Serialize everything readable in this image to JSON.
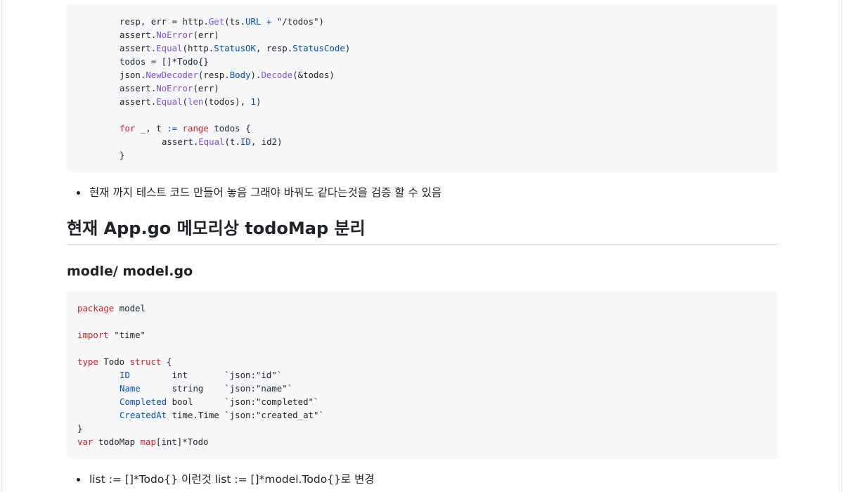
{
  "code_block_1": {
    "lines": [
      "resp, err = http.Get(ts.URL + \"/todos\")",
      "assert.NoError(err)",
      "assert.Equal(http.StatusOK, resp.StatusCode)",
      "todos = []*Todo{}",
      "json.NewDecoder(resp.Body).Decode(&todos)",
      "assert.NoError(err)",
      "assert.Equal(len(todos), 1)",
      "",
      "for _, t := range todos {",
      "assert.Equal(t.ID, id2)",
      "}"
    ]
  },
  "bullet_1": "현재 까지 테스트 코드 만들어 놓음 그래야 바꿔도 같다는것을 검증 할 수 있음",
  "heading_2": "현재 App.go 메모리상 todoMap 분리",
  "heading_3": "modle/ model.go",
  "code_block_2": {
    "lines": [
      "package model",
      "",
      "import \"time\"",
      "",
      "type Todo struct {",
      "ID        int       `json:\"id\"`",
      "Name      string    `json:\"name\"`",
      "Completed bool      `json:\"completed\"`",
      "CreatedAt time.Time `json:\"created_at\"`",
      "}",
      "var todoMap map[int]*Todo"
    ]
  },
  "bullet_2": "list := []*Todo{} 이런것 list := []*model.Todo{}로 변경",
  "colors": {
    "keyword": "#cf222e",
    "function": "#8250df",
    "property": "#0550ae",
    "code_background": "#f6f8fa",
    "text": "#1f2328"
  }
}
